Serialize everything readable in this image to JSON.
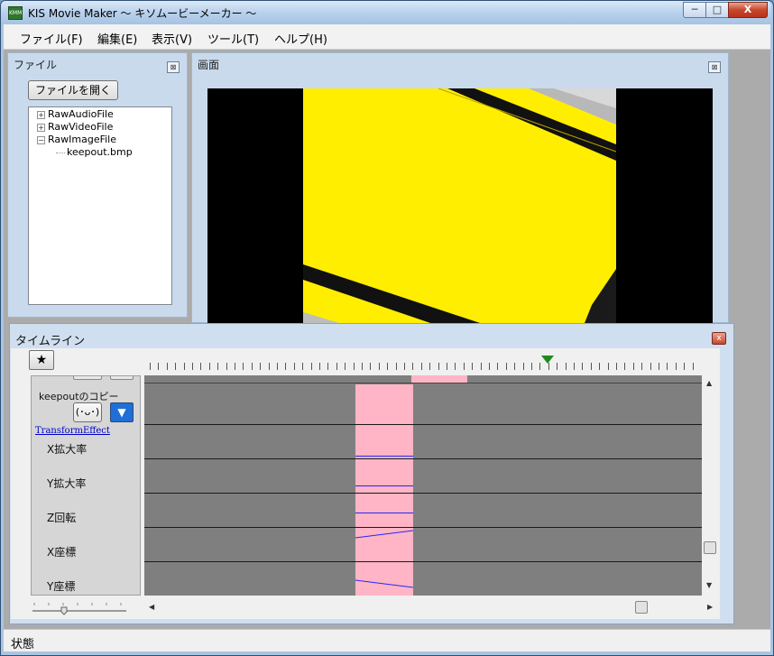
{
  "window": {
    "title": "KIS Movie Maker  ～ キソムービーメーカー ～",
    "icon_text": "KMM",
    "min_glyph": "─",
    "max_glyph": "□",
    "close_glyph": "X"
  },
  "menu": {
    "items": [
      "ファイル(F)",
      "編集(E)",
      "表示(V)",
      "ツール(T)",
      "ヘルプ(H)"
    ]
  },
  "file_panel": {
    "title": "ファイル",
    "close_glyph": "⊠",
    "open_button": "ファイルを開く",
    "tree": [
      {
        "label": "RawAudioFile",
        "toggle": "+"
      },
      {
        "label": "RawVideoFile",
        "toggle": "+"
      },
      {
        "label": "RawImageFile",
        "toggle": "−"
      },
      {
        "label": "keepout.bmp",
        "toggle": ""
      }
    ]
  },
  "screen_panel": {
    "title": "画面",
    "close_glyph": "⊠"
  },
  "timeline": {
    "title": "タイムライン",
    "close_glyph": "x",
    "star_label": "★",
    "object_name": "keepoutのコピー",
    "face_button": "(･ᴗ･)",
    "dropdown_glyph": "▼",
    "effect_link": "TransformEffect",
    "params": [
      "X拡大率",
      "Y拡大率",
      "Z回転",
      "X座標",
      "Y座標"
    ],
    "scroll_up": "▲",
    "scroll_down": "▼",
    "scroll_left": "◀",
    "scroll_right": "▶"
  },
  "status": {
    "text": "状態"
  },
  "colors": {
    "clip": "#ffb5c5",
    "track_bg": "#7f7f7f",
    "keyframe_line": "#2424ff",
    "preview_yellow": "#ffee00",
    "playhead": "#1e8a1e"
  }
}
